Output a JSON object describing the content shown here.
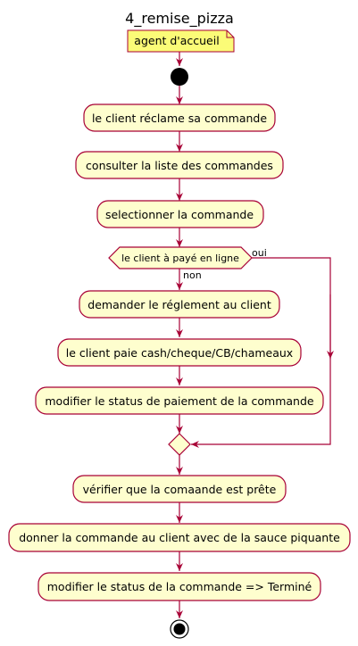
{
  "diagram": {
    "title": "4_remise_pizza",
    "note": "agent d'accueil",
    "steps_before": [
      "le client réclame sa commande",
      "consulter la liste des commandes",
      "selectionner la commande"
    ],
    "decision": {
      "condition": "le client à payé en ligne",
      "yes_label": "oui",
      "no_label": "non"
    },
    "no_branch_steps": [
      "demander le réglement au client",
      "le client paie cash/cheque/CB/chameaux",
      "modifier le status de paiement de la commande"
    ],
    "steps_after": [
      "vérifier que la comaande est prête",
      "donner la commande au client avec de la sauce piquante",
      "modifier le status de la commande => Terminé"
    ]
  },
  "colors": {
    "activity_fill": "#FEFECE",
    "note_fill": "#FBFB77",
    "border": "#A80036",
    "node": "#000000"
  }
}
